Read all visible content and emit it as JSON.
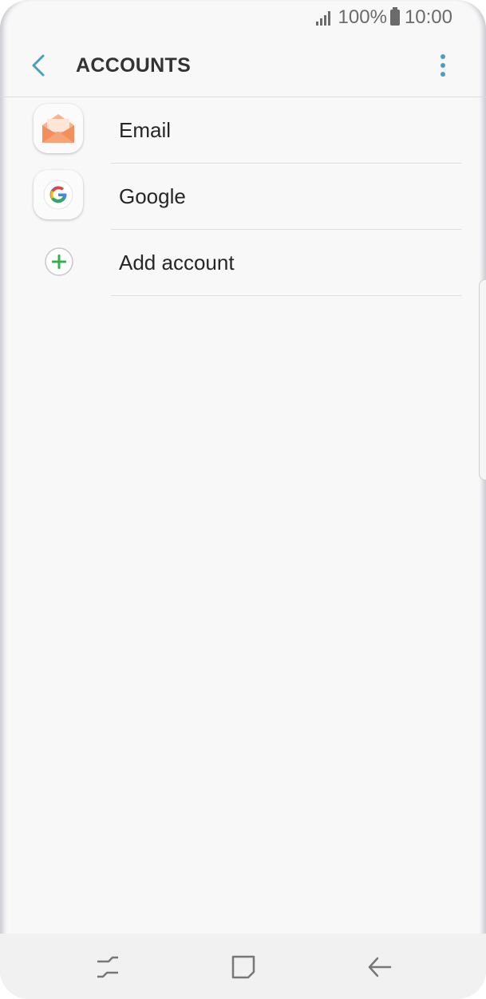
{
  "status_bar": {
    "battery": "100%",
    "time": "10:00",
    "icons": [
      "signal-icon",
      "battery-icon"
    ]
  },
  "app_bar": {
    "title": "ACCOUNTS",
    "back_icon": "back-arrow-icon",
    "more_icon": "more-vert-icon"
  },
  "accounts": [
    {
      "label": "Email",
      "icon": "email-envelope-icon"
    },
    {
      "label": "Google",
      "icon": "google-g-icon"
    },
    {
      "label": "Add account",
      "icon": "add-circle-icon"
    }
  ],
  "nav_bar": {
    "icons": [
      "recent-apps-icon",
      "home-icon",
      "back-icon"
    ]
  },
  "colors": {
    "accent": "#4a9fc0",
    "add_green": "#34b14a",
    "email_orange": "#f48f5c"
  }
}
